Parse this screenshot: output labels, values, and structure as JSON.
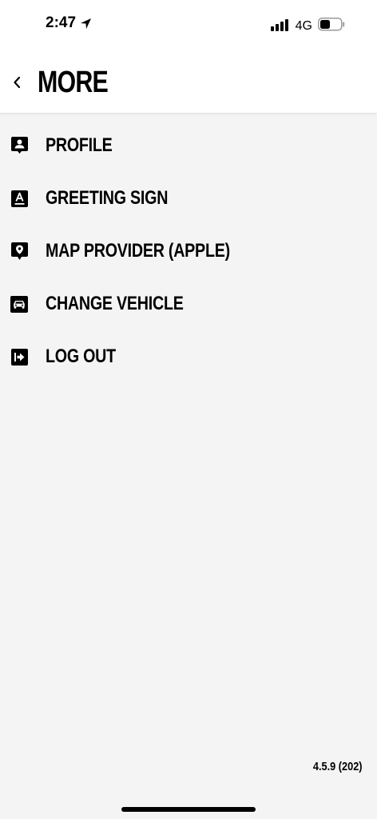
{
  "status_bar": {
    "time": "2:47",
    "network": "4G"
  },
  "header": {
    "title": "MORE"
  },
  "menu": {
    "items": [
      {
        "label": "PROFILE",
        "icon": "profile-icon"
      },
      {
        "label": "GREETING SIGN",
        "icon": "greeting-sign-icon"
      },
      {
        "label": "MAP PROVIDER (APPLE)",
        "icon": "map-pin-icon"
      },
      {
        "label": "CHANGE VEHICLE",
        "icon": "car-icon"
      },
      {
        "label": "LOG OUT",
        "icon": "logout-icon"
      }
    ]
  },
  "footer": {
    "version": "4.5.9 (202)"
  }
}
